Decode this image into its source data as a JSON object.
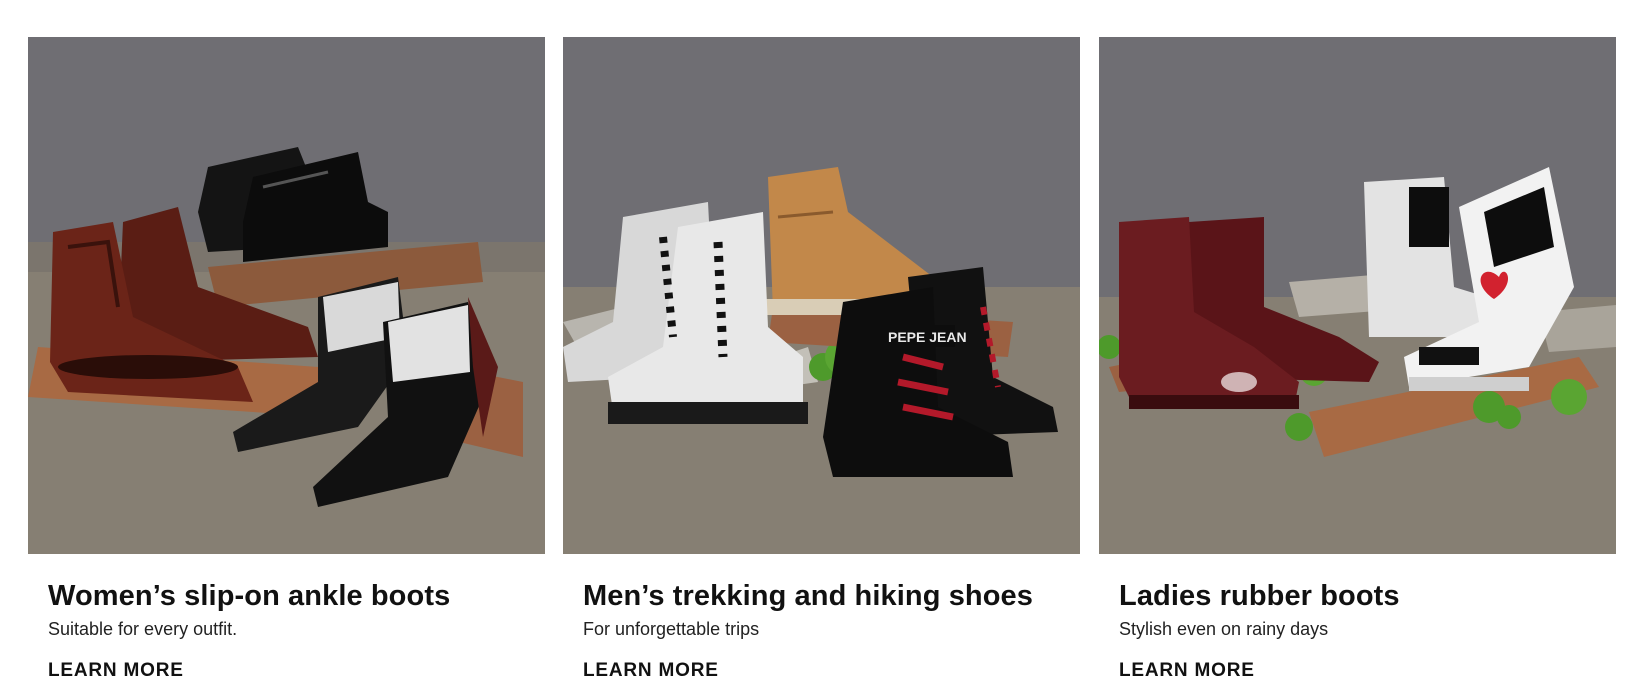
{
  "cards": [
    {
      "image_alt": "Women's ankle boots in leather and patent",
      "title": "Women’s slip-on ankle boots",
      "subtitle": "Suitable for every outfit.",
      "cta": "LEARN MORE"
    },
    {
      "image_alt": "Trekking boots in white, tan and black",
      "title": "Men’s trekking and hiking shoes",
      "subtitle": "For unforgettable trips",
      "cta": "LEARN MORE",
      "boot_brand_text": "PEPE JEAN"
    },
    {
      "image_alt": "Rubber chelsea boots in burgundy and white",
      "title": "Ladies rubber boots",
      "subtitle": "Stylish even on rainy days",
      "cta": "LEARN MORE"
    }
  ],
  "colors": {
    "backdrop": "#6f6e73",
    "floor": "#867f73",
    "burgundy": "#6b1c20",
    "wood": "#a86a44",
    "moss": "#4e9a2b"
  }
}
